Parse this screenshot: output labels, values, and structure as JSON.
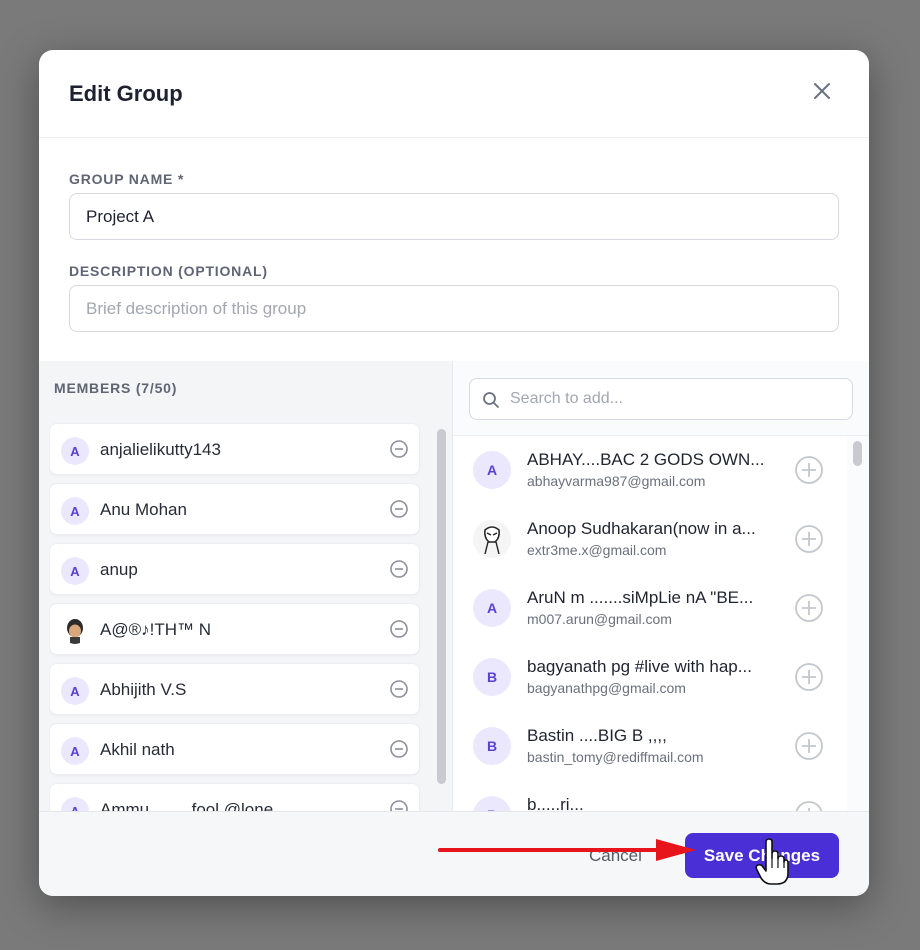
{
  "dialog": {
    "title": "Edit Group"
  },
  "form": {
    "group_name_label": "GROUP NAME *",
    "group_name_value": "Project A",
    "description_label": "DESCRIPTION (OPTIONAL)",
    "description_placeholder": "Brief description of this group",
    "description_value": ""
  },
  "members": {
    "heading": "MEMBERS (7/50)",
    "items": [
      {
        "initial": "A",
        "name": "anjalielikutty143",
        "avatar": "letter"
      },
      {
        "initial": "A",
        "name": "Anu Mohan",
        "avatar": "letter"
      },
      {
        "initial": "A",
        "name": "anup",
        "avatar": "letter"
      },
      {
        "initial": "",
        "name": "A@®♪!TH™ N",
        "avatar": "photo"
      },
      {
        "initial": "A",
        "name": "Abhijith V.S",
        "avatar": "letter"
      },
      {
        "initial": "A",
        "name": "Akhil nath",
        "avatar": "letter"
      },
      {
        "initial": "A",
        "name": "Ammu ....... fool @lone",
        "avatar": "letter"
      }
    ]
  },
  "search": {
    "placeholder": "Search to add...",
    "value": ""
  },
  "results": [
    {
      "initial": "A",
      "name": "ABHAY....BAC 2 GODS OWN...",
      "email": "abhayvarma987@gmail.com",
      "avatar": "letter"
    },
    {
      "initial": "",
      "name": "Anoop Sudhakaran(now in a...",
      "email": "extr3me.x@gmail.com",
      "avatar": "photo"
    },
    {
      "initial": "A",
      "name": "AruN m .......siMpLie nA \"BE...",
      "email": "m007.arun@gmail.com",
      "avatar": "letter"
    },
    {
      "initial": "B",
      "name": "bagyanath pg #live with hap...",
      "email": "bagyanathpg@gmail.com",
      "avatar": "letter"
    },
    {
      "initial": "B",
      "name": "Bastin ....BIG B ,,,,",
      "email": "bastin_tomy@rediffmail.com",
      "avatar": "letter"
    },
    {
      "initial": "B",
      "name": "b.....ri...",
      "email": "",
      "avatar": "letter"
    }
  ],
  "footer": {
    "cancel_label": "Cancel",
    "save_label": "Save Changes"
  },
  "colors": {
    "accent": "#4b2fd6",
    "avatar_bg": "#ebe8fd",
    "avatar_text": "#5643d6",
    "annotation_arrow": "#e8141b"
  },
  "icons": {
    "close": "close-icon",
    "remove": "minus-circle-icon",
    "add": "plus-circle-icon",
    "search": "search-icon"
  }
}
